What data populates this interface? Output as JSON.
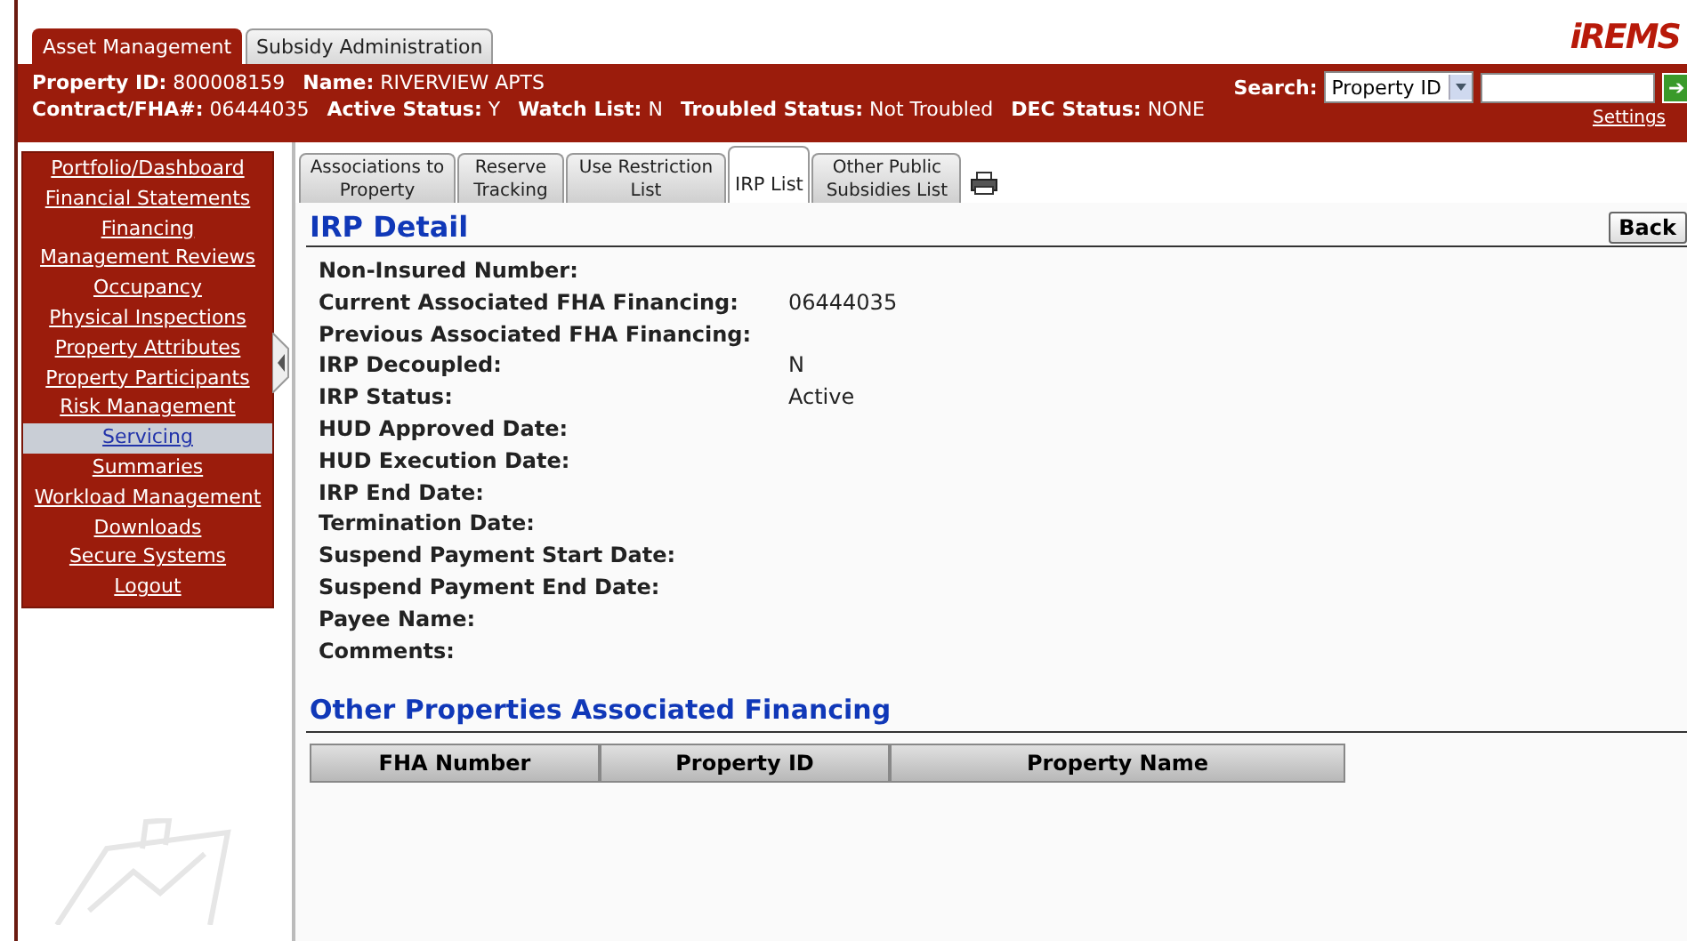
{
  "app_tabs": [
    {
      "label": "Asset Management",
      "selected": true
    },
    {
      "label": "Subsidy Administration",
      "selected": false
    }
  ],
  "logo": "iREMS",
  "header": {
    "line_1": [
      {
        "label": "Property ID:",
        "value": "800008159"
      },
      {
        "label": "Name:",
        "value": "RIVERVIEW APTS"
      }
    ],
    "line_2": [
      {
        "label": "Contract/FHA#:",
        "value": "06444035"
      },
      {
        "label": "Active Status:",
        "value": "Y"
      },
      {
        "label": "Watch List:",
        "value": "N"
      },
      {
        "label": "Troubled Status:",
        "value": "Not Troubled"
      },
      {
        "label": "DEC Status:",
        "value": "NONE"
      }
    ],
    "search": {
      "label": "Search:",
      "option": "Property ID",
      "go": "➔",
      "settings": "Settings"
    }
  },
  "sidebar": {
    "items": [
      {
        "label": "Portfolio/Dashboard",
        "selected": false
      },
      {
        "label": "Financial Statements",
        "selected": false
      },
      {
        "label": "Financing",
        "selected": false
      },
      {
        "label": "Management Reviews",
        "selected": false
      },
      {
        "label": "Occupancy",
        "selected": false
      },
      {
        "label": "Physical Inspections",
        "selected": false
      },
      {
        "label": "Property Attributes",
        "selected": false
      },
      {
        "label": "Property Participants",
        "selected": false
      },
      {
        "label": "Risk Management",
        "selected": false
      },
      {
        "label": "Servicing",
        "selected": true
      },
      {
        "label": "Summaries",
        "selected": false
      },
      {
        "label": "Workload Management",
        "selected": false
      },
      {
        "label": "Downloads",
        "selected": false
      },
      {
        "label": "Secure Systems",
        "selected": false
      },
      {
        "label": "Logout",
        "selected": false
      }
    ]
  },
  "tabs": [
    {
      "label": "Associations to Property",
      "selected": false
    },
    {
      "label": "Reserve Tracking",
      "selected": false
    },
    {
      "label": "Use Restriction List",
      "selected": false
    },
    {
      "label": "IRP List",
      "selected": true
    },
    {
      "label": "Other Public Subsidies List",
      "selected": false
    }
  ],
  "detail": {
    "title": "IRP Detail",
    "back_button": "Back",
    "fields": [
      {
        "label": "Non-Insured Number:"
      },
      {
        "label": "Current Associated FHA Financing:",
        "value": "06444035"
      },
      {
        "label": "Previous Associated FHA Financing:"
      },
      {
        "label": "IRP Decoupled:",
        "value": "N"
      },
      {
        "label": "IRP Status:",
        "value": "Active"
      },
      {
        "label": "HUD Approved Date:"
      },
      {
        "label": "HUD Execution Date:"
      },
      {
        "label": "IRP End Date:"
      },
      {
        "label": "Termination Date:"
      },
      {
        "label": "Suspend Payment Start Date:"
      },
      {
        "label": "Suspend Payment End Date:"
      },
      {
        "label": "Payee Name:"
      },
      {
        "label": "Comments:"
      }
    ]
  },
  "other_properties": {
    "title": "Other Properties Associated Financing",
    "table": {
      "columns": [
        "FHA Number",
        "Property ID",
        "Property Name"
      ]
    }
  }
}
